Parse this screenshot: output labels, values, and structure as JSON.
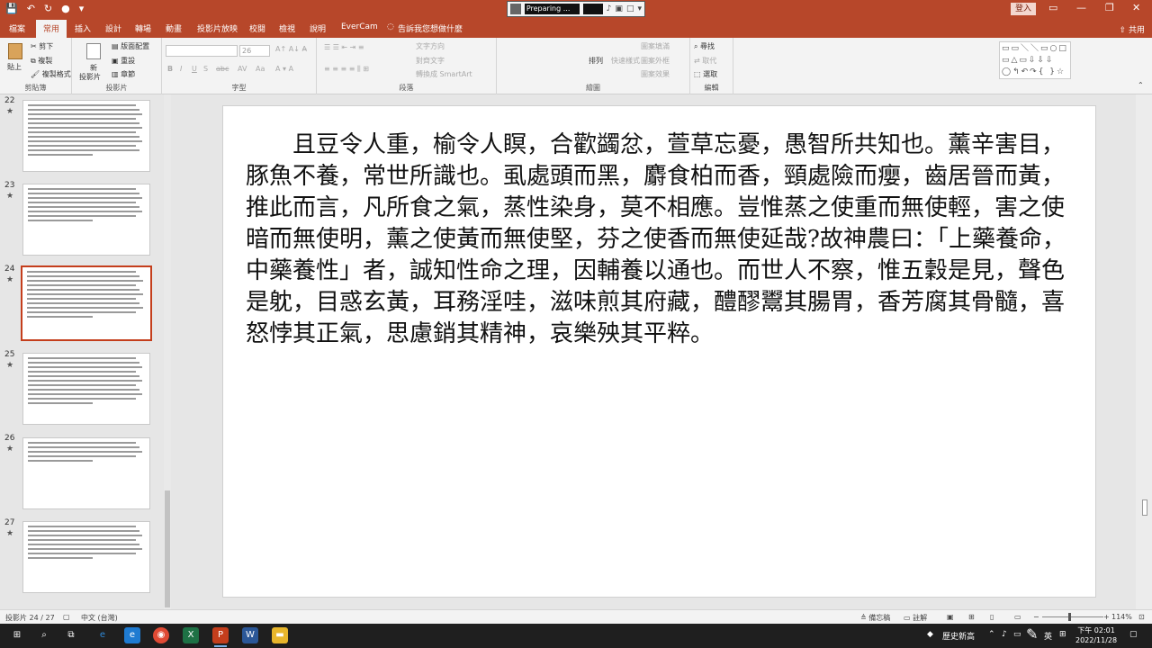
{
  "titlebar": {
    "preparing_label": "Preparing ...",
    "signin_label": "登入",
    "restore_icon": "restore-window-icon",
    "minimize_icon": "minimize-icon",
    "close_icon": "close-icon"
  },
  "tabs": [
    {
      "label": "檔案"
    },
    {
      "label": "常用"
    },
    {
      "label": "插入"
    },
    {
      "label": "設計"
    },
    {
      "label": "轉場"
    },
    {
      "label": "動畫"
    },
    {
      "label": "投影片放映"
    },
    {
      "label": "校閱"
    },
    {
      "label": "檢視"
    },
    {
      "label": "說明"
    },
    {
      "label": "EverCam"
    },
    {
      "label": "告訴我您想做什麼"
    }
  ],
  "share_label": "共用",
  "ribbon": {
    "clipboard": {
      "label": "剪貼簿",
      "paste": "貼上",
      "cut": "剪下",
      "copy": "複製",
      "format_painter": "複製格式"
    },
    "slides": {
      "label": "投影片",
      "new_slide": "新",
      "new_slide2": "投影片",
      "layout": "版面配置",
      "reset": "重設",
      "section": "章節"
    },
    "font": {
      "label": "字型",
      "size": "26"
    },
    "paragraph": {
      "label": "段落",
      "text_direction": "文字方向",
      "align_text": "對齊文字",
      "smartart": "轉換成 SmartArt"
    },
    "drawing": {
      "label": "繪圖",
      "arrange": "排列",
      "quick_styles": "快速樣式",
      "fill": "圖案填滿",
      "outline": "圖案外框",
      "effects": "圖案效果"
    },
    "editing": {
      "label": "編輯",
      "find": "尋找",
      "replace": "取代",
      "select": "選取"
    }
  },
  "thumbnails": [
    {
      "num": "22",
      "lines": 12
    },
    {
      "num": "23",
      "lines": 8
    },
    {
      "num": "24",
      "lines": 11
    },
    {
      "num": "25",
      "lines": 11
    },
    {
      "num": "26",
      "lines": 5
    },
    {
      "num": "27",
      "lines": 8
    }
  ],
  "slide": {
    "text": "　　且豆令人重，榆令人瞑，合歡蠲忿，萱草忘憂，愚智所共知也。薰辛害目，豚魚不養，常世所識也。虱處頭而黑，麝食柏而香，頸處險而癭，齒居晉而黃，推此而言，凡所食之氣，蒸性染身，莫不相應。豈惟蒸之使重而無使輕，害之使暗而無使明，薰之使黃而無使堅，芬之使香而無使延哉?故神農曰：「上藥養命，中藥養性」者，誠知性命之理，因輔養以通也。而世人不察，惟五穀是見，聲色是躭，目惑玄黃，耳務淫哇，滋味煎其府藏，醴醪鬻其腸胃，香芳腐其骨髓，喜怒悖其正氣，思慮銷其精神，哀樂殃其平粹。"
  },
  "status": {
    "slide_pos": "投影片 24 / 27",
    "language": "中文 (台灣)",
    "notes": "備忘稿",
    "comments": "註解",
    "zoom": "114%"
  },
  "taskbar": {
    "news": "歷史新高",
    "ime": "英",
    "time": "下午 02:01",
    "date": "2022/11/28"
  }
}
